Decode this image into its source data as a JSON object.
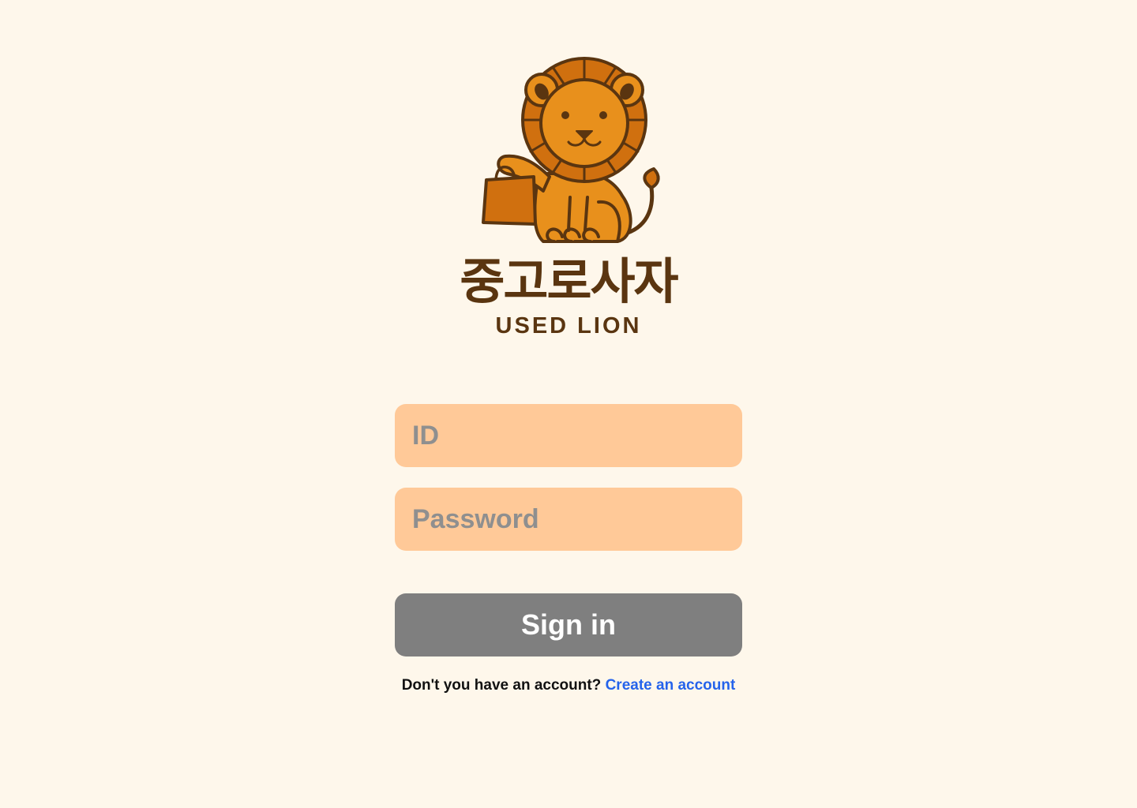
{
  "brand": {
    "name_ko": "중고로사자",
    "name_en": "USED LION",
    "logo_icon": "lion-with-shopping-bag-icon"
  },
  "login": {
    "id_placeholder": "ID",
    "password_placeholder": "Password",
    "signin_label": "Sign in"
  },
  "signup": {
    "prompt": "Don't you have an account?",
    "link_label": "Create an account"
  },
  "colors": {
    "background": "#fef7eb",
    "input_fill": "#ffc998",
    "button_fill": "#7f7f7f",
    "brand_brown": "#5a3510",
    "link_blue": "#2563eb",
    "lion_orange": "#e8901c",
    "mane_orange": "#d0700f"
  }
}
